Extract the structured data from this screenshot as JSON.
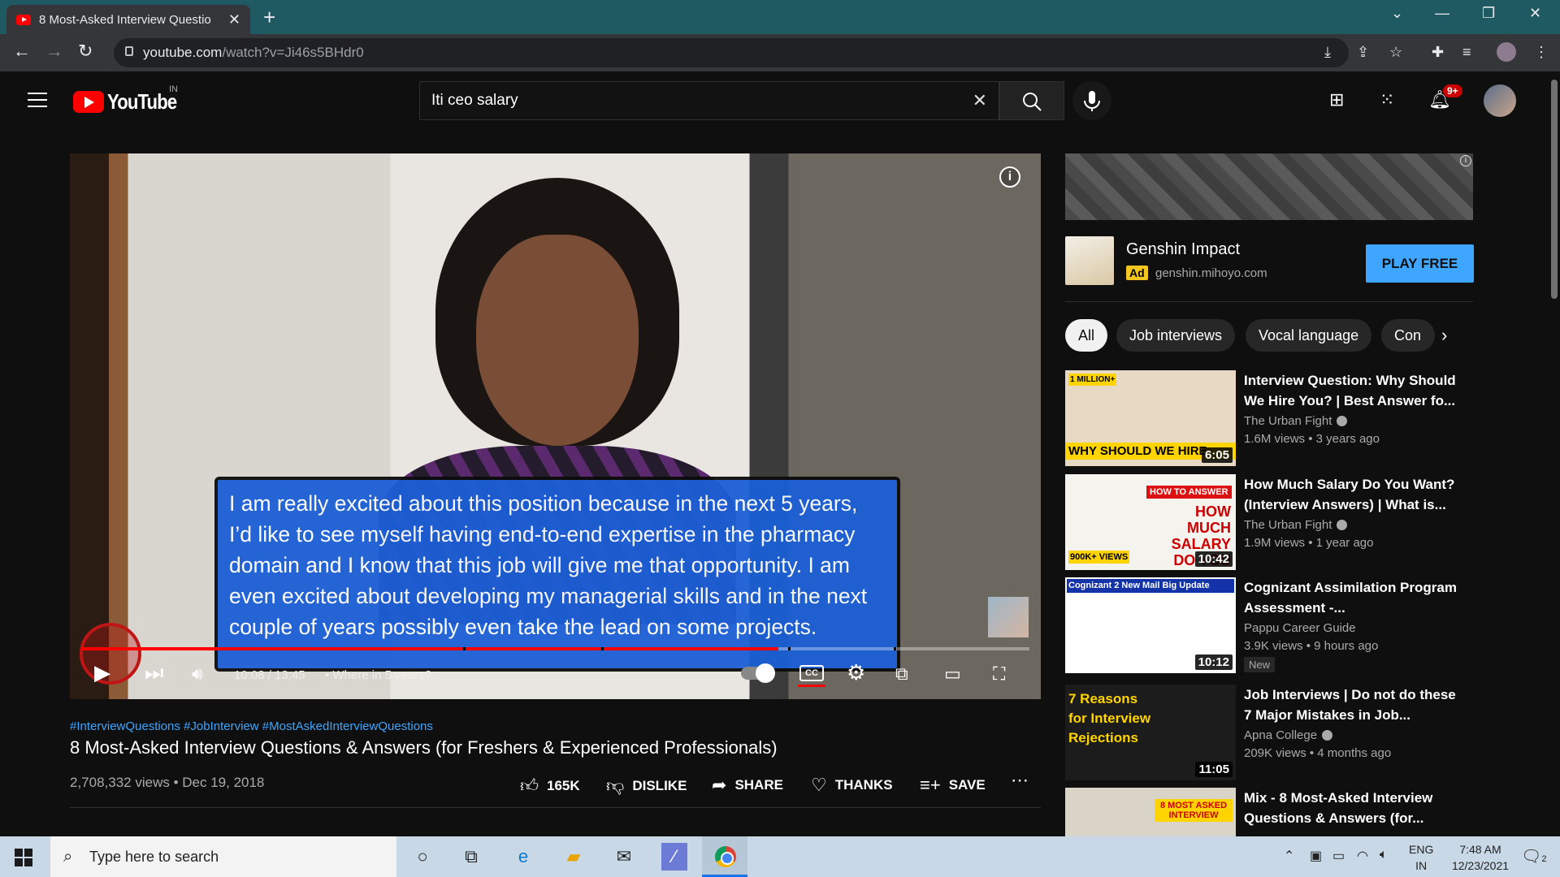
{
  "browser": {
    "tab_title": "8 Most-Asked Interview Questio",
    "url_host": "youtube.com",
    "url_path": "/watch?v=Ji46s5BHdr0"
  },
  "header": {
    "logo_text": "YouTube",
    "country": "IN",
    "search_value": "Iti ceo salary",
    "notif_count": "9+"
  },
  "player": {
    "caption": "I am really excited about this position because in the next 5 years, I’d like to see myself having end-to-end expertise in the pharmacy domain and I know that this job will give me that opportunity. I am even excited about developing my managerial skills and in the next couple of years possibly even take the lead on some projects.",
    "time": "10:08 / 13:45",
    "chapter": "• Where in 5 years?",
    "progress": 0.735,
    "cc_label": "CC"
  },
  "video": {
    "tags": "#InterviewQuestions #JobInterview #MostAskedInterviewQuestions",
    "title": "8 Most-Asked Interview Questions & Answers (for Freshers & Experienced Professionals)",
    "meta": "2,708,332 views • Dec 19, 2018",
    "likes": "165K",
    "dislike": "DISLIKE",
    "share": "SHARE",
    "thanks": "THANKS",
    "save": "SAVE"
  },
  "ad": {
    "title": "Genshin Impact",
    "badge": "Ad",
    "domain": "genshin.mihoyo.com",
    "button": "PLAY FREE"
  },
  "chips": [
    "All",
    "Job interviews",
    "Vocal language",
    "Con"
  ],
  "recs": [
    {
      "title": "Interview Question: Why Should We Hire You? | Best Answer fo...",
      "channel": "The Urban Fight",
      "verified": true,
      "meta": "1.6M views • 3 years ago",
      "duration": "6:05",
      "thumb_text": "WHY SHOULD WE HIRE",
      "badge": "",
      "thumb_color": "#e8d9c4"
    },
    {
      "title": "How Much Salary Do You Want? (Interview Answers) | What is...",
      "channel": "The Urban Fight",
      "verified": true,
      "meta": "1.9M views • 1 year ago",
      "duration": "10:42",
      "thumb_text": "HOW MUCH SALARY DO YOU WANT?",
      "badge": "",
      "thumb_color": "#f5f3ee"
    },
    {
      "title": "Cognizant Assimilation Program Assessment -...",
      "channel": "Pappu Career Guide",
      "verified": false,
      "meta": "3.9K views • 9 hours ago",
      "duration": "10:12",
      "thumb_text": "Cognizant 2 New Mail Big Update",
      "badge": "New",
      "thumb_color": "#ffffff"
    },
    {
      "title": "Job Interviews | Do not do these 7 Major Mistakes in Job...",
      "channel": "Apna College",
      "verified": true,
      "meta": "209K views • 4 months ago",
      "duration": "11:05",
      "thumb_text": "7 Reasons for Interview Rejections",
      "badge": "",
      "thumb_color": "#1c1c1c"
    },
    {
      "title": "Mix - 8 Most-Asked Interview Questions & Answers (for...",
      "channel": "",
      "verified": false,
      "meta": "",
      "duration": "",
      "thumb_text": "8 MOST ASKED INTERVIEW",
      "badge": "",
      "thumb_color": "#d9d3c8"
    }
  ],
  "taskbar": {
    "search_placeholder": "Type here to search",
    "lang1": "ENG",
    "lang2": "IN",
    "time": "7:48 AM",
    "date": "12/23/2021",
    "notif": "2"
  }
}
